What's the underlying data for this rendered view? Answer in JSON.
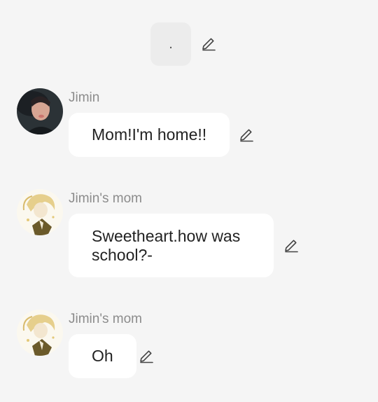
{
  "narration": {
    "text": "."
  },
  "messages": [
    {
      "sender": "Jimin",
      "text": "Mom!I'm home!!"
    },
    {
      "sender": "Jimin's mom",
      "text": "Sweetheart.how was school?-"
    },
    {
      "sender": "Jimin's mom",
      "text": "Oh"
    }
  ],
  "icons": {
    "edit": "pencil-icon"
  },
  "colors": {
    "background": "#f5f5f5",
    "bubble": "#ffffff",
    "narration_bubble": "#ececec",
    "sender_name": "#8c8c8c",
    "message_text": "#222222"
  }
}
